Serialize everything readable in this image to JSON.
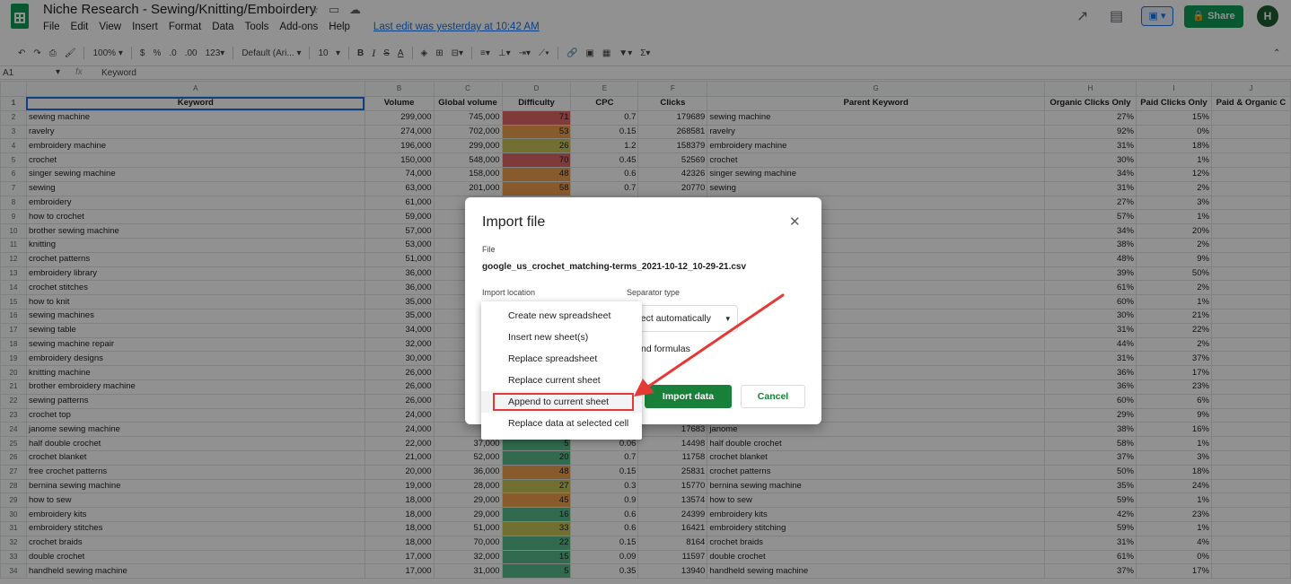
{
  "header": {
    "title": "Niche Research - Sewing/Knitting/Emboirdery",
    "menu": [
      "File",
      "Edit",
      "View",
      "Insert",
      "Format",
      "Data",
      "Tools",
      "Add-ons",
      "Help"
    ],
    "last_edit": "Last edit was yesterday at 10:42 AM",
    "share_label": "Share",
    "avatar_initial": "H"
  },
  "toolbar": {
    "zoom": "100%",
    "currency": "$",
    "percent": "%",
    "dec_less": ".0",
    "dec_more": ".00",
    "format_more": "123",
    "font": "Default (Ari...",
    "font_size": "10",
    "bold": "B",
    "italic": "I",
    "strike": "S",
    "text_color": "A",
    "sum": "Σ"
  },
  "formula_bar": {
    "cell_ref": "A1",
    "fx": "fx",
    "content": "Keyword"
  },
  "sheet": {
    "column_letters": [
      "A",
      "B",
      "C",
      "D",
      "E",
      "F",
      "G",
      "H",
      "I",
      "J"
    ],
    "headers": [
      "Keyword",
      "Volume",
      "Global volume",
      "Difficulty",
      "CPC",
      "Clicks",
      "Parent Keyword",
      "Organic Clicks Only",
      "Paid Clicks Only",
      "Paid & Organic C"
    ],
    "rows": [
      {
        "n": "2",
        "kw": "sewing machine",
        "vol": "299,000",
        "gv": "745,000",
        "d": "71",
        "cpc": "0.7",
        "cl": "179689",
        "pk": "sewing machine",
        "oc": "27%",
        "pc": "15%"
      },
      {
        "n": "3",
        "kw": "ravelry",
        "vol": "274,000",
        "gv": "702,000",
        "d": "53",
        "cpc": "0.15",
        "cl": "268581",
        "pk": "ravelry",
        "oc": "92%",
        "pc": "0%"
      },
      {
        "n": "4",
        "kw": "embroidery machine",
        "vol": "196,000",
        "gv": "299,000",
        "d": "26",
        "cpc": "1.2",
        "cl": "158379",
        "pk": "embroidery machine",
        "oc": "31%",
        "pc": "18%"
      },
      {
        "n": "5",
        "kw": "crochet",
        "vol": "150,000",
        "gv": "548,000",
        "d": "70",
        "cpc": "0.45",
        "cl": "52569",
        "pk": "crochet",
        "oc": "30%",
        "pc": "1%"
      },
      {
        "n": "6",
        "kw": "singer sewing machine",
        "vol": "74,000",
        "gv": "158,000",
        "d": "48",
        "cpc": "0.6",
        "cl": "42326",
        "pk": "singer sewing machine",
        "oc": "34%",
        "pc": "12%"
      },
      {
        "n": "7",
        "kw": "sewing",
        "vol": "63,000",
        "gv": "201,000",
        "d": "58",
        "cpc": "0.7",
        "cl": "20770",
        "pk": "sewing",
        "oc": "31%",
        "pc": "2%"
      },
      {
        "n": "8",
        "kw": "embroidery",
        "vol": "61,000",
        "gv": "",
        "d": "",
        "cpc": "",
        "cl": "",
        "pk": "",
        "oc": "27%",
        "pc": "3%"
      },
      {
        "n": "9",
        "kw": "how to crochet",
        "vol": "59,000",
        "gv": "",
        "d": "",
        "cpc": "",
        "cl": "",
        "pk": "",
        "oc": "57%",
        "pc": "1%"
      },
      {
        "n": "10",
        "kw": "brother sewing machine",
        "vol": "57,000",
        "gv": "",
        "d": "",
        "cpc": "",
        "cl": "",
        "pk": "",
        "oc": "34%",
        "pc": "20%"
      },
      {
        "n": "11",
        "kw": "knitting",
        "vol": "53,000",
        "gv": "",
        "d": "",
        "cpc": "",
        "cl": "",
        "pk": "",
        "oc": "38%",
        "pc": "2%"
      },
      {
        "n": "12",
        "kw": "crochet patterns",
        "vol": "51,000",
        "gv": "",
        "d": "",
        "cpc": "",
        "cl": "",
        "pk": "",
        "oc": "48%",
        "pc": "9%"
      },
      {
        "n": "13",
        "kw": "embroidery library",
        "vol": "36,000",
        "gv": "",
        "d": "",
        "cpc": "",
        "cl": "",
        "pk": "",
        "oc": "39%",
        "pc": "50%"
      },
      {
        "n": "14",
        "kw": "crochet stitches",
        "vol": "36,000",
        "gv": "",
        "d": "",
        "cpc": "",
        "cl": "",
        "pk": "",
        "oc": "61%",
        "pc": "2%"
      },
      {
        "n": "15",
        "kw": "how to knit",
        "vol": "35,000",
        "gv": "",
        "d": "",
        "cpc": "",
        "cl": "",
        "pk": "",
        "oc": "60%",
        "pc": "1%"
      },
      {
        "n": "16",
        "kw": "sewing machines",
        "vol": "35,000",
        "gv": "",
        "d": "",
        "cpc": "",
        "cl": "",
        "pk": "",
        "oc": "30%",
        "pc": "21%"
      },
      {
        "n": "17",
        "kw": "sewing table",
        "vol": "34,000",
        "gv": "",
        "d": "",
        "cpc": "",
        "cl": "",
        "pk": "",
        "oc": "31%",
        "pc": "22%"
      },
      {
        "n": "18",
        "kw": "sewing machine repair",
        "vol": "32,000",
        "gv": "",
        "d": "",
        "cpc": "",
        "cl": "",
        "pk": "",
        "oc": "44%",
        "pc": "2%"
      },
      {
        "n": "19",
        "kw": "embroidery designs",
        "vol": "30,000",
        "gv": "",
        "d": "",
        "cpc": "",
        "cl": "",
        "pk": "",
        "oc": "31%",
        "pc": "37%"
      },
      {
        "n": "20",
        "kw": "knitting machine",
        "vol": "26,000",
        "gv": "",
        "d": "",
        "cpc": "",
        "cl": "",
        "pk": "",
        "oc": "36%",
        "pc": "17%"
      },
      {
        "n": "21",
        "kw": "brother embroidery machine",
        "vol": "26,000",
        "gv": "",
        "d": "",
        "cpc": "",
        "cl": "",
        "pk": "",
        "oc": "36%",
        "pc": "23%"
      },
      {
        "n": "22",
        "kw": "sewing patterns",
        "vol": "26,000",
        "gv": "",
        "d": "",
        "cpc": "",
        "cl": "",
        "pk": "",
        "oc": "60%",
        "pc": "6%"
      },
      {
        "n": "23",
        "kw": "crochet top",
        "vol": "24,000",
        "gv": "",
        "d": "",
        "cpc": "",
        "cl": "",
        "pk": "",
        "oc": "29%",
        "pc": "9%"
      },
      {
        "n": "24",
        "kw": "janome sewing machine",
        "vol": "24,000",
        "gv": "47",
        "d": "",
        "cpc": "",
        "cl": "17683",
        "pk": "janome",
        "oc": "38%",
        "pc": "16%"
      },
      {
        "n": "25",
        "kw": "half double crochet",
        "vol": "22,000",
        "gv": "37,000",
        "d": "5",
        "cpc": "0.06",
        "cl": "14498",
        "pk": "half double crochet",
        "oc": "58%",
        "pc": "1%"
      },
      {
        "n": "26",
        "kw": "crochet blanket",
        "vol": "21,000",
        "gv": "52,000",
        "d": "20",
        "cpc": "0.7",
        "cl": "11758",
        "pk": "crochet blanket",
        "oc": "37%",
        "pc": "3%"
      },
      {
        "n": "27",
        "kw": "free crochet patterns",
        "vol": "20,000",
        "gv": "36,000",
        "d": "48",
        "cpc": "0.15",
        "cl": "25831",
        "pk": "crochet patterns",
        "oc": "50%",
        "pc": "18%"
      },
      {
        "n": "28",
        "kw": "bernina sewing machine",
        "vol": "19,000",
        "gv": "28,000",
        "d": "27",
        "cpc": "0.3",
        "cl": "15770",
        "pk": "bernina sewing machine",
        "oc": "35%",
        "pc": "24%"
      },
      {
        "n": "29",
        "kw": "how to sew",
        "vol": "18,000",
        "gv": "29,000",
        "d": "45",
        "cpc": "0.9",
        "cl": "13574",
        "pk": "how to sew",
        "oc": "59%",
        "pc": "1%"
      },
      {
        "n": "30",
        "kw": "embroidery kits",
        "vol": "18,000",
        "gv": "29,000",
        "d": "16",
        "cpc": "0.6",
        "cl": "24399",
        "pk": "embroidery kits",
        "oc": "42%",
        "pc": "23%"
      },
      {
        "n": "31",
        "kw": "embroidery stitches",
        "vol": "18,000",
        "gv": "51,000",
        "d": "33",
        "cpc": "0.6",
        "cl": "16421",
        "pk": "embroidery stitching",
        "oc": "59%",
        "pc": "1%"
      },
      {
        "n": "32",
        "kw": "crochet braids",
        "vol": "18,000",
        "gv": "70,000",
        "d": "22",
        "cpc": "0.15",
        "cl": "8164",
        "pk": "crochet braids",
        "oc": "31%",
        "pc": "4%"
      },
      {
        "n": "33",
        "kw": "double crochet",
        "vol": "17,000",
        "gv": "32,000",
        "d": "15",
        "cpc": "0.09",
        "cl": "11597",
        "pk": "double crochet",
        "oc": "61%",
        "pc": "0%"
      },
      {
        "n": "34",
        "kw": "handheld sewing machine",
        "vol": "17,000",
        "gv": "31,000",
        "d": "5",
        "cpc": "0.35",
        "cl": "13940",
        "pk": "handheld sewing machine",
        "oc": "37%",
        "pc": "17%"
      }
    ]
  },
  "dialog": {
    "title": "Import file",
    "file_label": "File",
    "file_name": "google_us_crochet_matching-terms_2021-10-12_10-29-21.csv",
    "location_label": "Import location",
    "separator_label": "Separator type",
    "separator_value": "etect automatically",
    "formulas_text": "nd formulas",
    "import_button": "Import data",
    "cancel_button": "Cancel"
  },
  "location_menu": {
    "items": [
      "Create new spreadsheet",
      "Insert new sheet(s)",
      "Replace spreadsheet",
      "Replace current sheet",
      "Append to current sheet",
      "Replace data at selected cell"
    ],
    "highlighted": "Append to current sheet"
  },
  "colors": {
    "accent_green": "#188038",
    "annotation_red": "#e53935",
    "diff_red": "#e06666",
    "diff_orange": "#f0a150",
    "diff_yellow": "#c9c35a",
    "diff_green": "#57bb8a"
  }
}
